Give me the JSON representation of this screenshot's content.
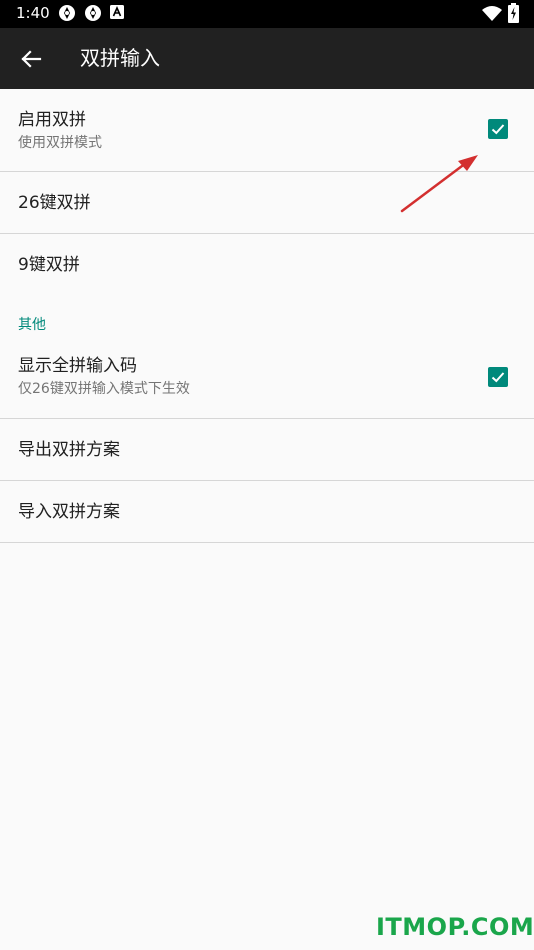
{
  "status_bar": {
    "time": "1:40",
    "notification_icons": [
      "app-icon",
      "app-icon",
      "keyboard-a-icon"
    ],
    "system_icons": [
      "wifi-icon",
      "battery-charging-icon"
    ]
  },
  "app_bar": {
    "back_icon": "back-arrow-icon",
    "title": "双拼输入"
  },
  "settings": [
    {
      "title": "启用双拼",
      "summary": "使用双拼模式",
      "checked": true
    },
    {
      "title": "26键双拼"
    },
    {
      "title": "9键双拼"
    }
  ],
  "other": {
    "header": "其他",
    "items": [
      {
        "title": "显示全拼输入码",
        "summary": "仅26键双拼输入模式下生效",
        "checked": true
      },
      {
        "title": "导出双拼方案"
      },
      {
        "title": "导入双拼方案"
      }
    ]
  },
  "annotation": {
    "type": "red-arrow-icon",
    "color": "#d32f2f"
  },
  "colors": {
    "accent": "#00897b",
    "app_bar": "#212121",
    "background": "#fafafa"
  },
  "watermark": "ITMOP.COM"
}
